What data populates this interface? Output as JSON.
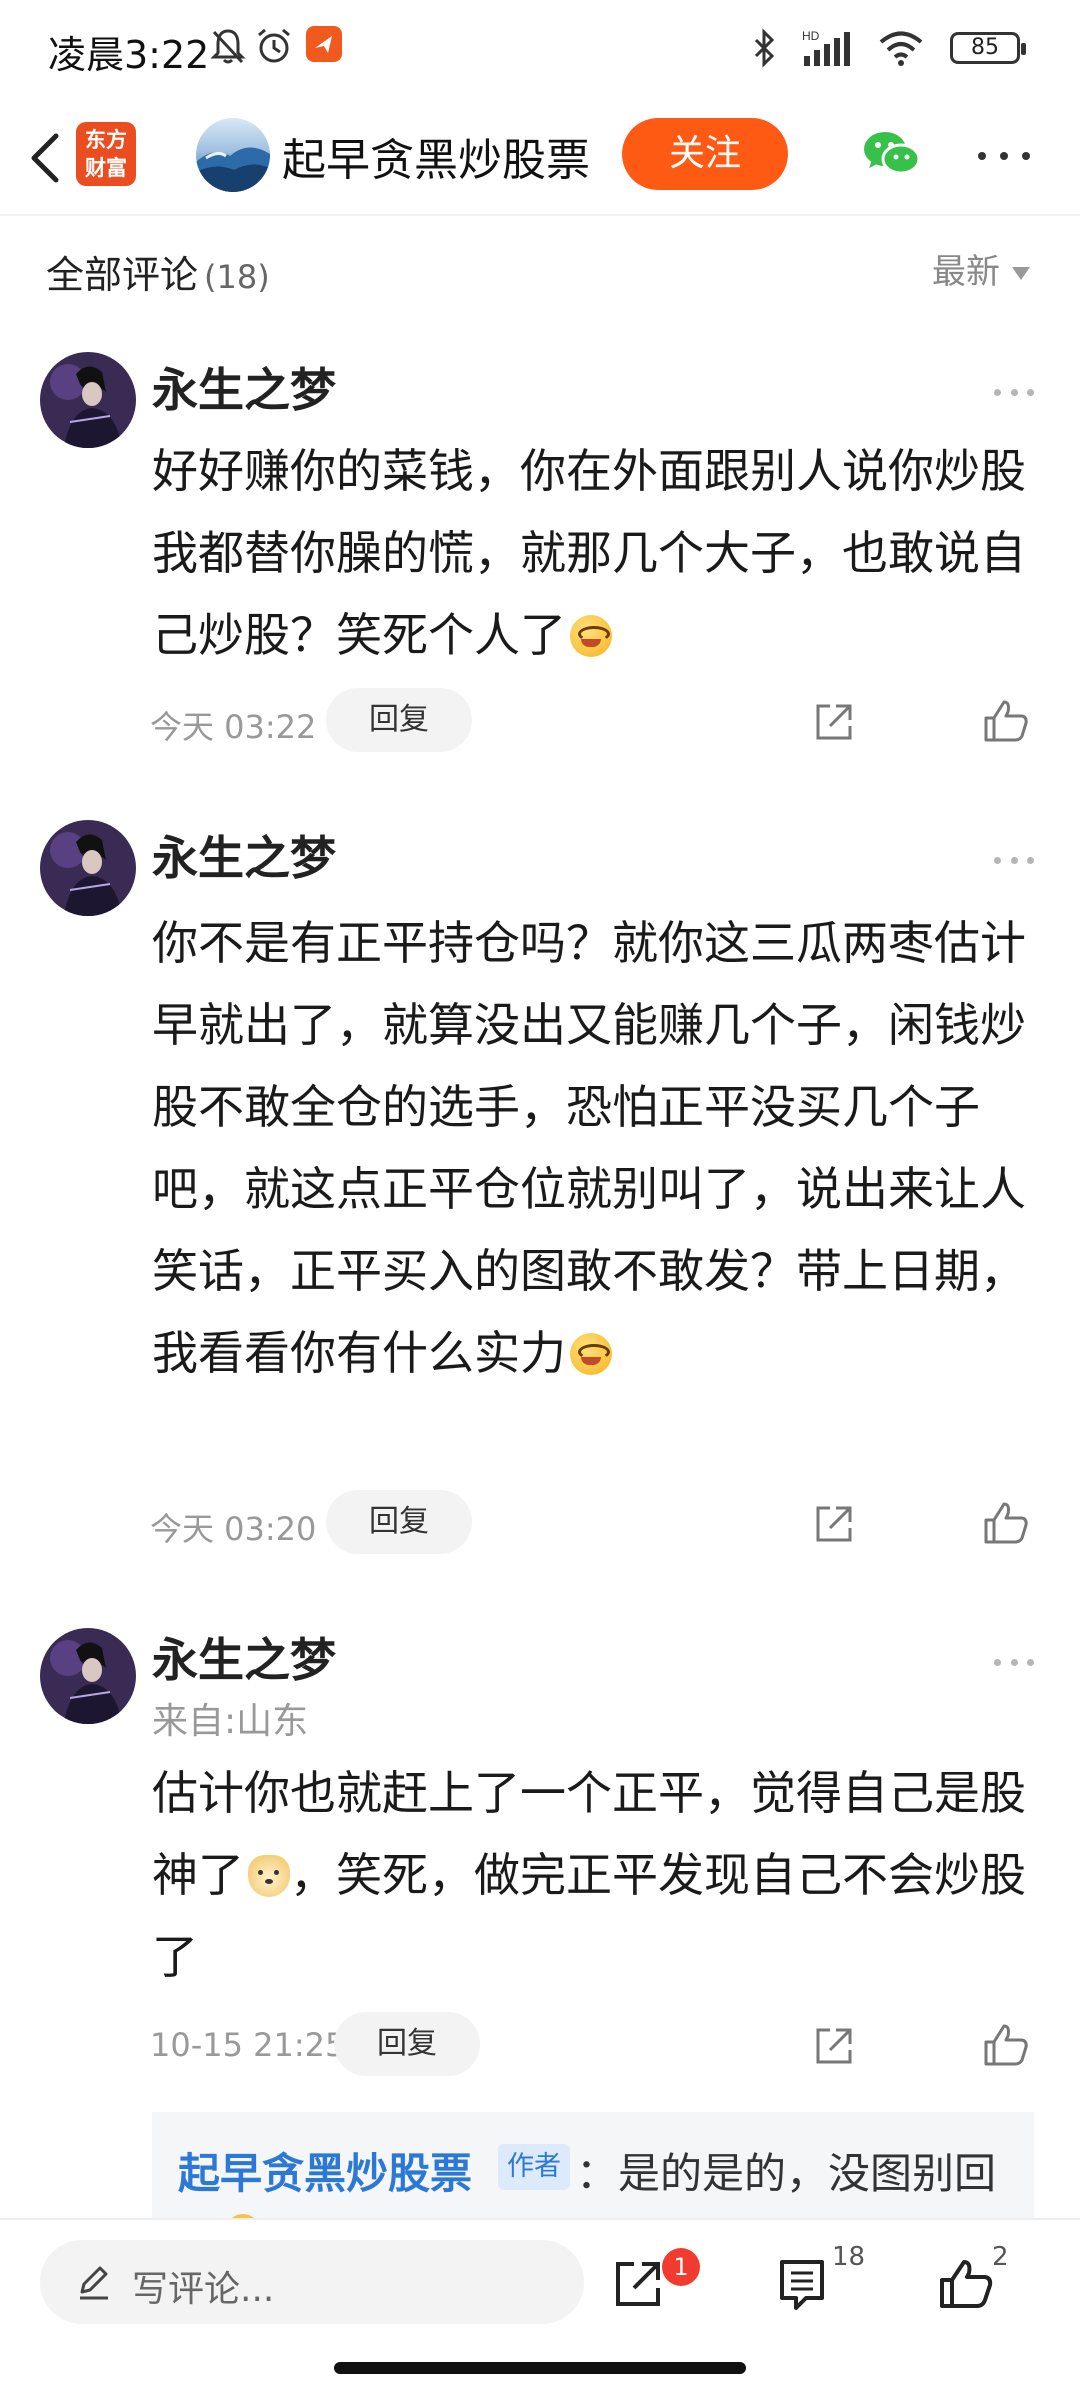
{
  "status_bar": {
    "time": "凌晨3:22",
    "battery": "85",
    "icons": [
      "mute-bell-icon",
      "alarm-icon",
      "app-notification-icon",
      "bluetooth-icon",
      "hd-signal-icon",
      "wifi-icon"
    ]
  },
  "header": {
    "brand_line1": "东方",
    "brand_line2": "财富",
    "title": "起早贪黑炒股票",
    "follow_label": "关注",
    "icons": [
      "back-icon",
      "wechat-icon",
      "more-icon"
    ]
  },
  "comments_section": {
    "title": "全部评论",
    "count": "(18)",
    "sort_label": "最新"
  },
  "comments": [
    {
      "name": "永生之梦",
      "text": "好好赚你的菜钱，你在外面跟别人说你炒股我都替你臊的慌，就那几个大子，也敢说自己炒股？笑死个人了",
      "time": "今天 03:22",
      "reply_label": "回复"
    },
    {
      "name": "永生之梦",
      "text": "你不是有正平持仓吗？就你这三瓜两枣估计早就出了，就算没出又能赚几个子，闲钱炒股不敢全仓的选手，恐怕正平没买几个子吧，就这点正平仓位就别叫了，说出来让人笑话，正平买入的图敢不敢发？带上日期，我看看你有什么实力",
      "time": "今天 03:20",
      "reply_label": "回复"
    },
    {
      "name": "永生之梦",
      "location": "来自:山东",
      "text_part1": "估计你也就赶上了一个正平，觉得自己是股神了",
      "text_part2": "，笑死，做完正平发现自己不会炒股了",
      "time": "10-15 21:25",
      "reply_label": "回复"
    }
  ],
  "author_reply": {
    "name": "起早贪黑炒股票",
    "badge": "作者",
    "text": "：是的是的，没图别回"
  },
  "bottom_bar": {
    "compose_placeholder": "写评论...",
    "share_badge": "1",
    "comment_count": "18",
    "like_count": "2"
  },
  "colors": {
    "accent": "#ff5a14",
    "brand": "#ea4d1f",
    "link_blue": "#2b78d6",
    "badge_red": "#f23b30"
  }
}
